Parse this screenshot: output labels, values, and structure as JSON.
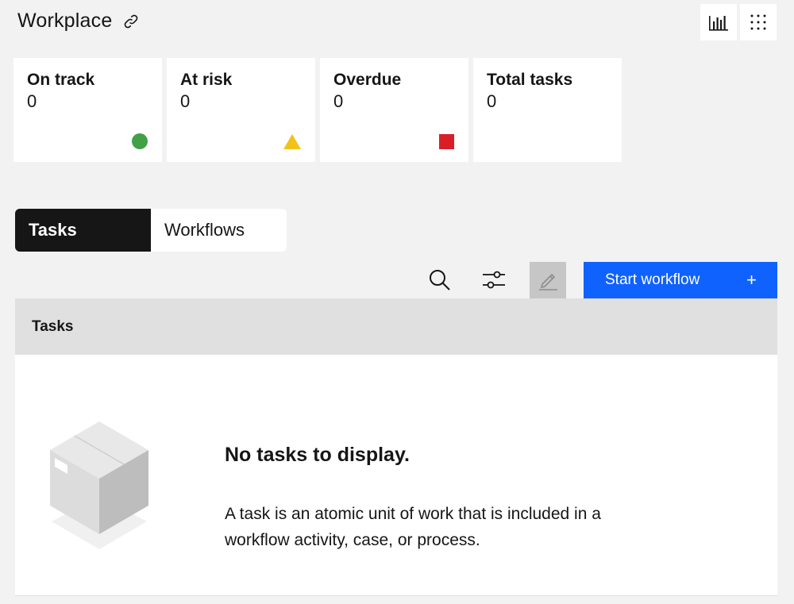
{
  "header": {
    "title": "Workplace",
    "link_icon": "link-icon"
  },
  "top_actions": [
    {
      "icon": "chart-bar-icon",
      "label": "Chart view"
    },
    {
      "icon": "app-grid-icon",
      "label": "App switcher"
    }
  ],
  "cards": [
    {
      "label": "On track",
      "value": "0",
      "status": "on-track",
      "color": "#42a047"
    },
    {
      "label": "At risk",
      "value": "0",
      "status": "at-risk",
      "color": "#f1c21b"
    },
    {
      "label": "Overdue",
      "value": "0",
      "status": "overdue",
      "color": "#da1e28"
    },
    {
      "label": "Total tasks",
      "value": "0"
    }
  ],
  "tabs": [
    {
      "label": "Tasks",
      "active": true
    },
    {
      "label": "Workflows",
      "active": false
    }
  ],
  "toolbar": {
    "search_icon": "search-icon",
    "filter_icon": "filter-sliders-icon",
    "edit_icon": "edit-icon",
    "start_workflow_label": "Start workflow",
    "plus": "+"
  },
  "table": {
    "header": "Tasks"
  },
  "empty_state": {
    "title": "No tasks to display.",
    "description": "A task is an atomic unit of work that is included in a workflow activity, case, or process."
  },
  "colors": {
    "primary": "#0f62fe",
    "active_tab": "#161616",
    "background": "#f2f2f2"
  }
}
